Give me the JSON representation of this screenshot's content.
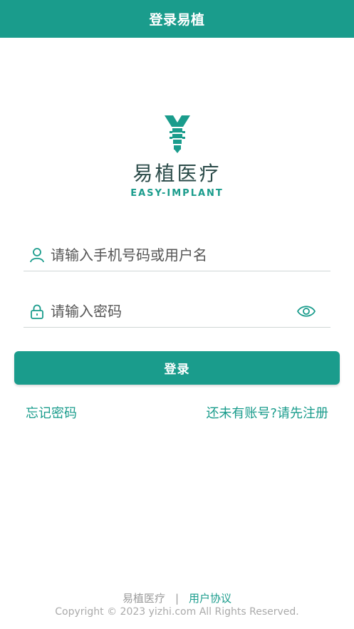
{
  "header": {
    "title": "登录易植"
  },
  "logo": {
    "name_cn": "易植医疗",
    "name_en": "EASY-IMPLANT"
  },
  "form": {
    "phone_placeholder": "请输入手机号码或用户名",
    "password_placeholder": "请输入密码",
    "login_label": "登录"
  },
  "links": {
    "forgot": "忘记密码",
    "register": "还未有账号?请先注册"
  },
  "footer": {
    "brand": "易植医疗",
    "separator": "|",
    "agreement": "用户协议",
    "copyright": "Copyright © 2023 yizhi.com All Rights Reserved."
  },
  "colors": {
    "accent": "#1a9c8c"
  },
  "icons": [
    "logo-mark-icon",
    "user-icon",
    "lock-icon",
    "eye-icon"
  ]
}
